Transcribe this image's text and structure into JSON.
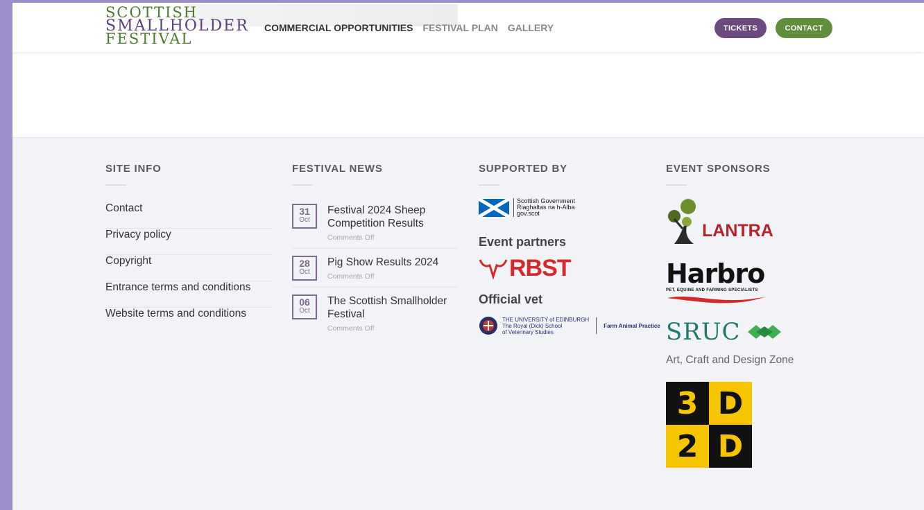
{
  "header": {
    "logo": {
      "line1": "SCOTTISH",
      "line2": "SMALLHOLDER",
      "line3": "FESTIVAL"
    },
    "nav": [
      {
        "label": "COMMERCIAL OPPORTUNITIES",
        "active": true
      },
      {
        "label": "FESTIVAL PLAN",
        "active": false
      },
      {
        "label": "GALLERY",
        "active": false
      }
    ],
    "tickets_label": "TICKETS",
    "contact_label": "CONTACT",
    "colors": {
      "tickets": "#6b4a7d",
      "contact": "#5f8e3d"
    }
  },
  "footer": {
    "site_info": {
      "title": "SITE INFO",
      "links": [
        "Contact",
        "Privacy policy",
        "Copyright",
        "Entrance terms and conditions",
        "Website terms and conditions"
      ]
    },
    "festival_news": {
      "title": "FESTIVAL NEWS",
      "items": [
        {
          "day": "31",
          "month": "Oct",
          "title": "Festival 2024 Sheep Competition Results",
          "meta": "Comments Off"
        },
        {
          "day": "28",
          "month": "Oct",
          "title": "Pig Show Results 2024",
          "meta": "Comments Off"
        },
        {
          "day": "06",
          "month": "Oct",
          "title": "The Scottish Smallholder Festival",
          "meta": "Comments Off"
        }
      ]
    },
    "supported_by": {
      "title": "SUPPORTED BY",
      "gov_lines": [
        "Scottish Government",
        "Riaghaltas na h-Alba",
        "gov.scot"
      ],
      "event_partners": "Event partners",
      "rbst": "RBST",
      "official_vet": "Official vet",
      "uni_lines": [
        "THE UNIVERSITY of EDINBURGH",
        "The Royal (Dick) School",
        "of Veterinary Studies"
      ],
      "uni_practice": "Farm Animal Practice"
    },
    "event_sponsors": {
      "title": "EVENT SPONSORS",
      "lantra": "LANTRA",
      "harbro": "Harbro",
      "harbro_sub": "PET, EQUINE AND FARMING SPECIALISTS",
      "sruc": "SRUC",
      "art_zone": "Art, Craft and Design Zone",
      "grid": [
        "3",
        "D",
        "2",
        "D"
      ]
    }
  }
}
